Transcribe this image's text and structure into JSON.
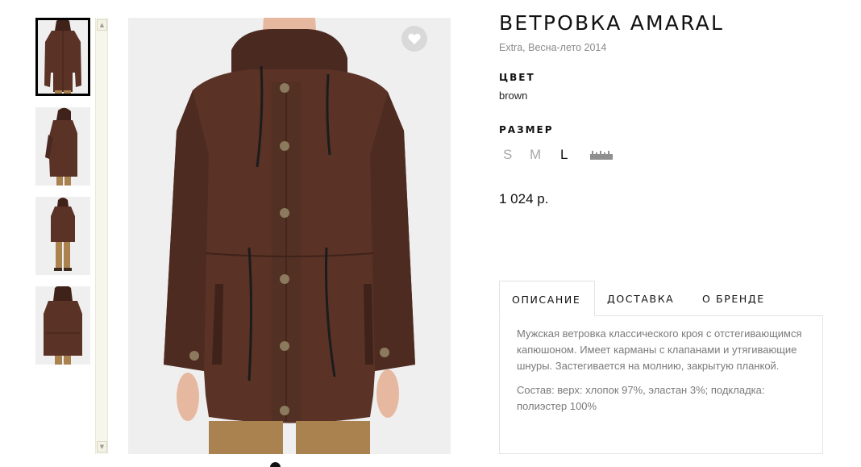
{
  "product": {
    "title": "ВЕТРОВКА AMARAL",
    "subtitle": "Extra, Весна-лето 2014",
    "color_label": "ЦВЕТ",
    "color_value": "brown",
    "size_label": "РАЗМЕР",
    "sizes": [
      {
        "label": "S",
        "available": false
      },
      {
        "label": "M",
        "available": false
      },
      {
        "label": "L",
        "available": true
      }
    ],
    "size_chart_icon": "ruler-icon",
    "price": "1 024 р."
  },
  "gallery": {
    "thumbnail_views": [
      "front",
      "side",
      "full-length",
      "back"
    ],
    "selected_index": 0,
    "favorite_icon": "heart-icon",
    "scroll_up_glyph": "▲",
    "scroll_down_glyph": "▼"
  },
  "tabs": [
    {
      "label": "ОПИСАНИЕ",
      "active": true
    },
    {
      "label": "ДОСТАВКА",
      "active": false
    },
    {
      "label": "О БРЕНДЕ",
      "active": false
    }
  ],
  "description": {
    "text": "Мужская ветровка классического кроя с отстегивающимся капюшоном. Имеет карманы с клапанами и утягивающие шнуры. Застегивается на молнию, закрытую планкой.",
    "composition": "Состав: верх: хлопок 97%, эластан 3%; подкладка: полиэстер 100%"
  },
  "colors": {
    "jacket_brown": "#5a3226",
    "jacket_dark": "#3f2219",
    "photo_bg": "#efefef",
    "pants_khaki": "#a9824f",
    "skin": "#e7b8a0",
    "size_unavailable": "#a8a8a8",
    "size_available": "#111111"
  }
}
